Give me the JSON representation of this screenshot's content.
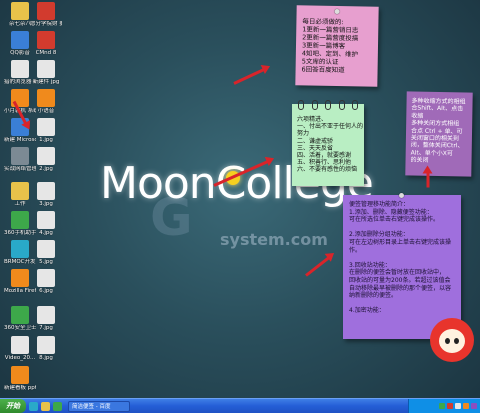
{
  "desktop": {
    "icons_col1": [
      {
        "label": "杂七杂八",
        "icon": "folder-icon"
      },
      {
        "label": "QQ影音",
        "icon": "qq-video-icon"
      },
      {
        "label": "猎豹浏览器 txt",
        "icon": "text-file-icon"
      },
      {
        "label": "小月装机 系统",
        "icon": "app-icon"
      },
      {
        "label": "新建 Microso...",
        "icon": "word-doc-icon"
      },
      {
        "label": "实战网络管理 钢琴录",
        "icon": "app-icon"
      },
      {
        "label": "工作",
        "icon": "folder-icon"
      },
      {
        "label": "360手机助手",
        "icon": "phone-assistant-icon"
      },
      {
        "label": "BRMOC开发 2015...",
        "icon": "app-icon"
      },
      {
        "label": "Mozilla Firefox",
        "icon": "firefox-icon"
      },
      {
        "label": "360安全卫士",
        "icon": "security-icon"
      },
      {
        "label": "Video_20...",
        "icon": "video-file-icon"
      },
      {
        "label": "新建看板 ppt",
        "icon": "ppt-file-icon"
      }
    ],
    "icons_col2": [
      {
        "label": "愿分学院财 要引擎",
        "icon": "app-icon"
      },
      {
        "label": "CMnd 8",
        "icon": "pdf-icon"
      },
      {
        "label": "新建件 jpg",
        "icon": "image-file-icon"
      },
      {
        "label": "小语音",
        "icon": "app-icon"
      },
      {
        "label": "1.jpg",
        "icon": "image-file-icon"
      },
      {
        "label": "2.jpg",
        "icon": "image-file-icon"
      },
      {
        "label": "3.jpg",
        "icon": "image-file-icon"
      },
      {
        "label": "4.jpg",
        "icon": "image-file-icon"
      },
      {
        "label": "5.jpg",
        "icon": "image-file-icon"
      },
      {
        "label": "6.jpg",
        "icon": "image-file-icon"
      },
      {
        "label": "7.jpg",
        "icon": "image-file-icon"
      },
      {
        "label": "8.jpg",
        "icon": "image-file-icon"
      }
    ]
  },
  "wallpaper": {
    "logo_text": "MoonCollege",
    "watermark_g": "G",
    "watermark_url": "system.com"
  },
  "notes": {
    "note1": "每日必须做的:\n1更新一篇营销日志\n2更新一篇营度投搞\n3更新一篇博客\n4知吧、定到、维护\n5文库的认证\n6回答百度知道",
    "note2": "六项精进、\n一、付出不亚于任何人的\n努力\n二、谦虚戒骄\n三、天天反省\n四、活着，就要感谢\n五、积善行、思利他\n六、不要有感性的烦恼",
    "note3": "多种收缩方式的相组\n合Shift、Alt、点击\n收缩\n多种关闭方式相组\n合点 Ctrl + 单、可\n关闭窗口的相关到\n闭，整体关闭Ctrl、\nAlt、单个小X可\n的关闭",
    "note4": "便签管理移功能简介：\n1.添加、删除、隐藏便签功能：\n可在所选位单击右键完成该操作。\n\n2.添加删除分组功能：\n可在左边树形目录上单击右键完成该操\n作。\n\n3.回收站功能：\n在删除的便签会暂时放在回收站中，\n回收站的可量为200条。若超过该值会\n自动移除最早被删除的那个便签，以容\n纳新删除的便签。\n\n4.加密功能："
  },
  "taskbar": {
    "start_label": "开始",
    "active_task": "简洁便签 - 百度"
  },
  "colors": {
    "note_pink": "#e79fcf",
    "note_green": "#b9eec3",
    "note_purple_small": "#a06ab8",
    "note_purple_large": "#9f6fdd",
    "arrow_red": "#d9242a",
    "taskbar_blue": "#245ed6"
  }
}
